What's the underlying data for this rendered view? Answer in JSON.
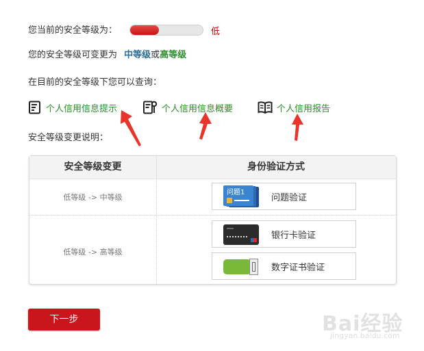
{
  "security": {
    "current_label": "您当前的安全等级为：",
    "level": "低",
    "level_fraction": 0.4,
    "changeable_prefix": "您的安全等级可变更为",
    "mid_level": "中等级",
    "or": "或",
    "high_level": "高等级",
    "query_prompt": "在目前的安全等级下您可以查询：",
    "change_note_title": "安全等级变更说明："
  },
  "query_links": [
    {
      "label": "个人信用信息提示",
      "icon": "document-list-icon"
    },
    {
      "label": "个人信用信息概要",
      "icon": "document-summary-icon"
    },
    {
      "label": "个人信用报告",
      "icon": "open-book-icon"
    }
  ],
  "table": {
    "headers": [
      "安全等级变更",
      "身份验证方式"
    ],
    "rows": [
      {
        "change": "低等级 -> 中等级",
        "methods": [
          "问题验证"
        ]
      },
      {
        "change": "低等级 -> 高等级",
        "methods": [
          "银行卡验证",
          "数字证书验证"
        ]
      }
    ],
    "question_card_text": "问题1"
  },
  "next_button": "下一步",
  "watermark": {
    "brand": "Bai经验",
    "url": "jingyan.baidu.com"
  },
  "colors": {
    "accent_red": "#c8161c",
    "link_green": "#2a8f2a",
    "mid_blue": "#2a6c95",
    "arrow_red": "#e8342a"
  }
}
